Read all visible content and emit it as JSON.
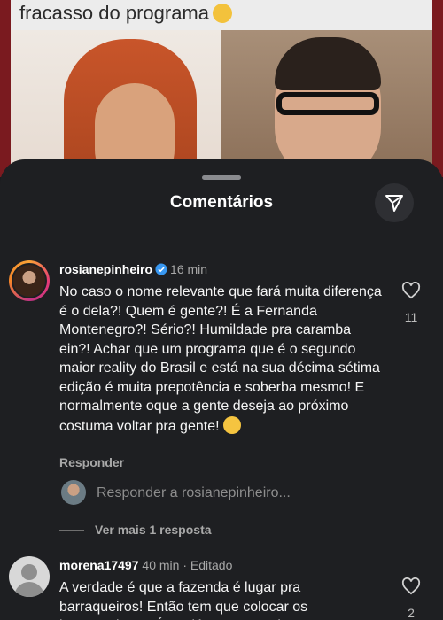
{
  "post": {
    "caption": "fracasso do programa",
    "caption_emoji": "flushed-face"
  },
  "sheet": {
    "title": "Comentários",
    "share_icon": "send-icon"
  },
  "comments": [
    {
      "username": "rosianepinheiro",
      "verified": true,
      "time": "16 min",
      "text": "No caso o nome relevante que fará muita diferença é o dela?! Quem é gente?! É a Fernanda Montenegro?! Sério?! Humildade pra caramba ein?! Achar que um programa que é o segundo maior reality do Brasil e está na sua décima sétima edição é muita prepotência e soberba mesmo! E normalmente oque a gente deseja ao próximo costuma voltar pra gente!",
      "trailing_emoji": "relieved-face",
      "reply_label": "Responder",
      "likes": "11",
      "reply_placeholder": "Responder a rosianepinheiro...",
      "more_replies": "Ver mais 1 resposta"
    },
    {
      "username": "morena17497",
      "time": "40 min",
      "edited": "· Editado",
      "text": "A verdade é que a fazenda é lugar pra barraqueiros! Então tem que colocar os barraqueiros... É so dá um pouco de",
      "likes": "2"
    }
  ]
}
